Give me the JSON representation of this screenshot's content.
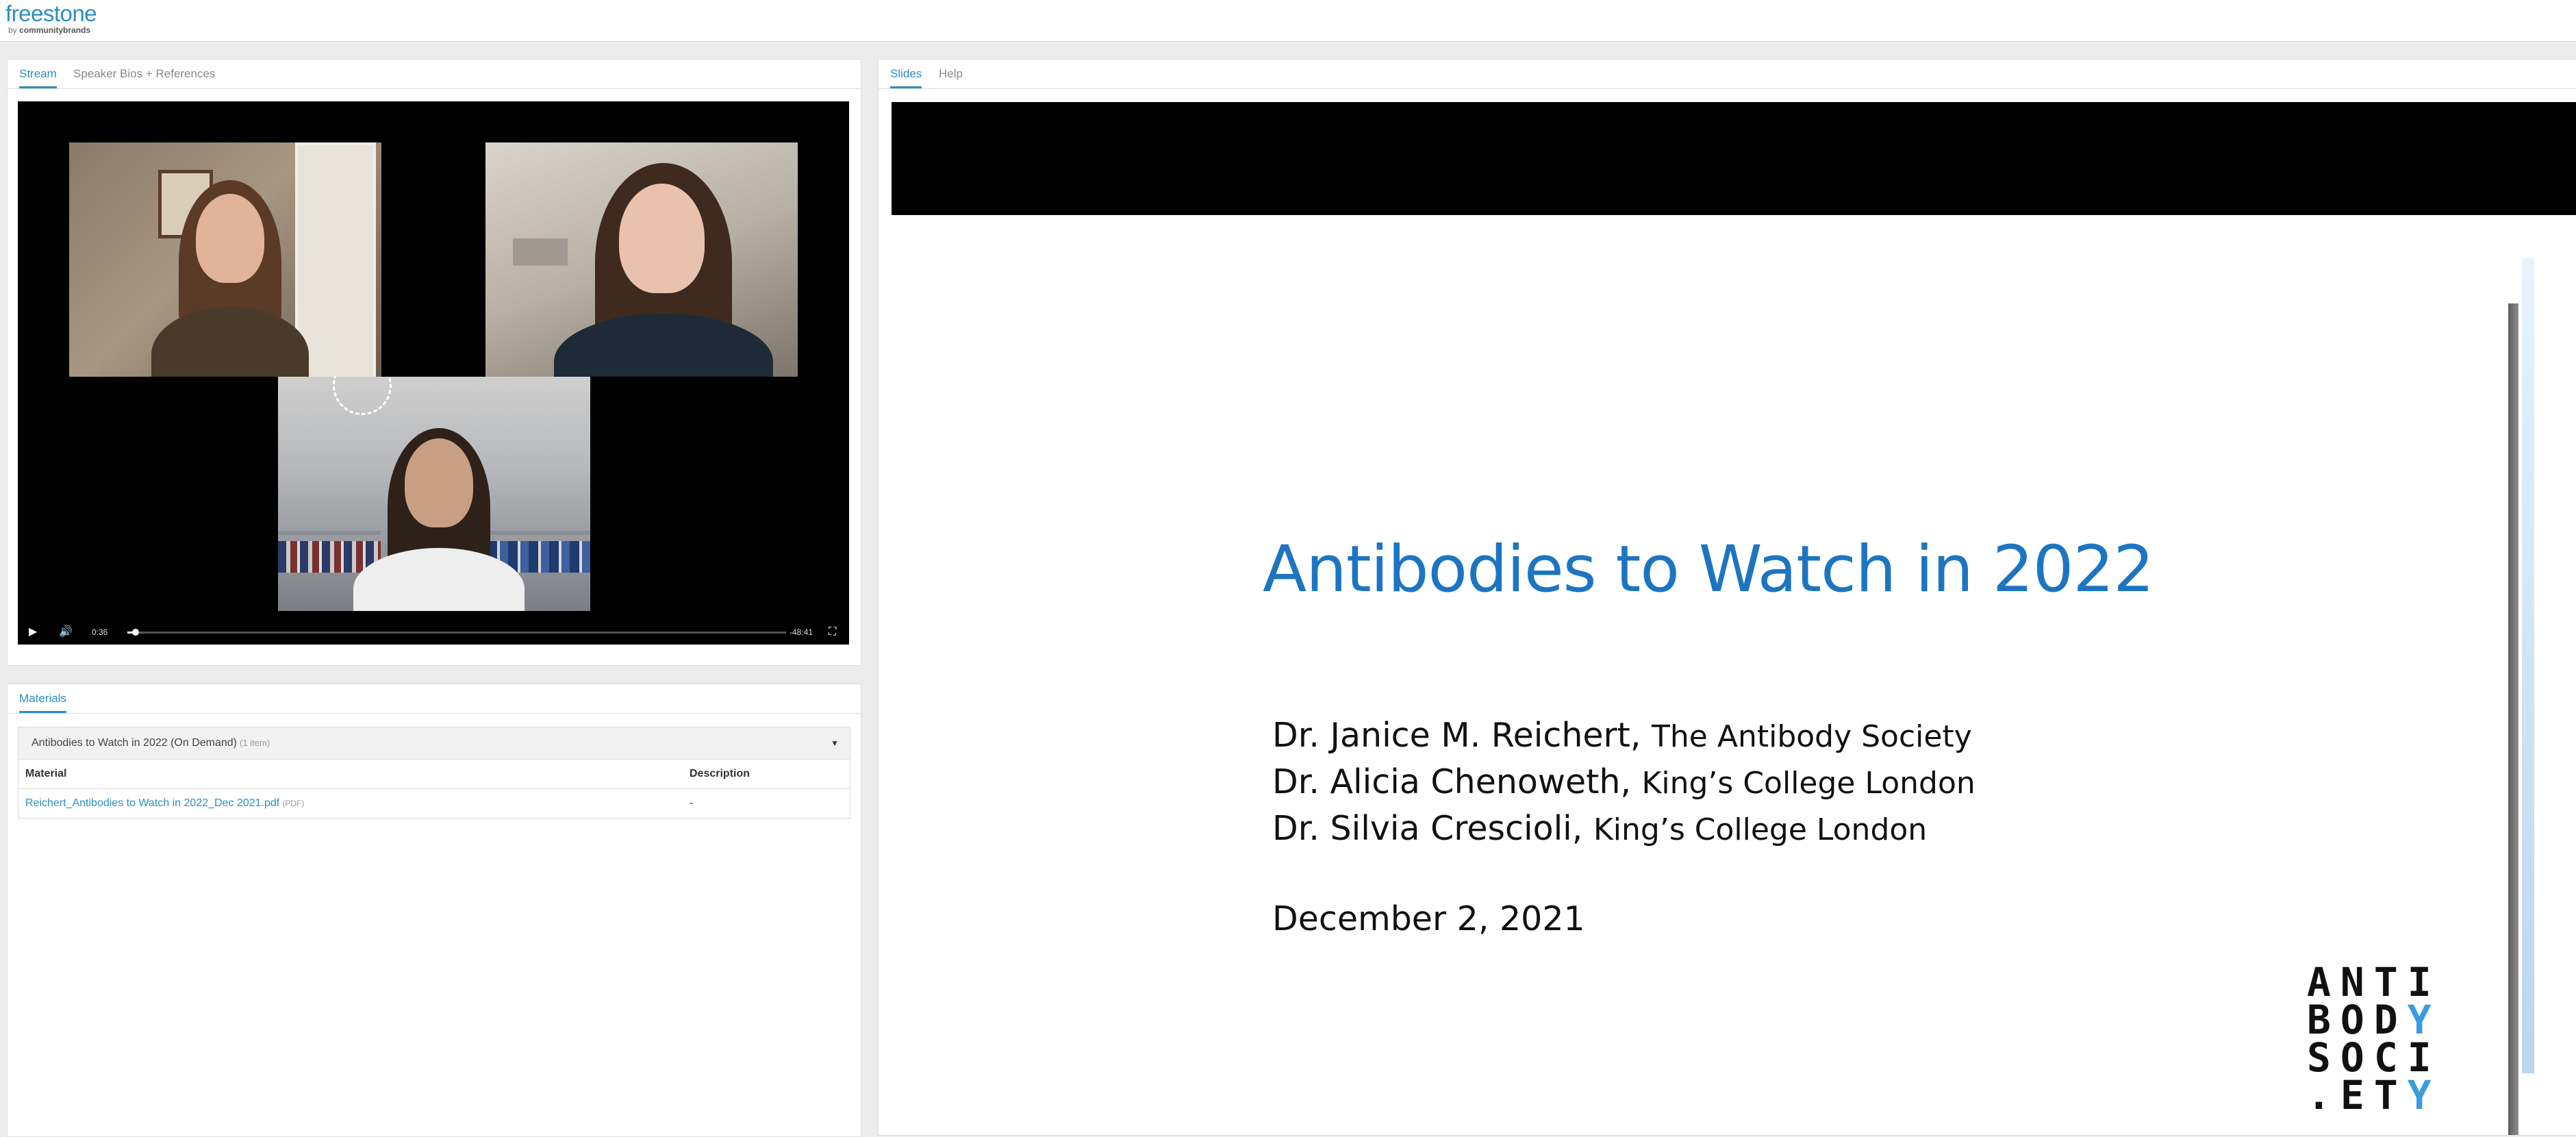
{
  "header": {
    "logo": "freestone",
    "logo_sub_prefix": "by",
    "logo_sub_brand": "communitybrands"
  },
  "stream_panel": {
    "tabs": [
      {
        "label": "Stream",
        "active": true
      },
      {
        "label": "Speaker Bios + References",
        "active": false
      }
    ],
    "player": {
      "current_time": "0:36",
      "remaining_time": "-48:41",
      "progress": 0.012
    }
  },
  "materials_panel": {
    "tab": "Materials",
    "collection": {
      "title": "Antibodies to Watch in 2022 (On Demand)",
      "count": "(1 item)"
    },
    "table": {
      "headers": [
        "Material",
        "Description"
      ],
      "rows": [
        {
          "material": "Reichert_Antibodies to Watch in 2022_Dec 2021.pdf",
          "type": "(PDF)",
          "description": "-"
        }
      ]
    }
  },
  "slides_panel": {
    "tabs": [
      {
        "label": "Slides",
        "active": true
      },
      {
        "label": "Help",
        "active": false
      }
    ],
    "slide": {
      "title": "Antibodies to Watch in 2022",
      "speakers": [
        {
          "name": "Dr. Janice M. Reichert,",
          "affiliation": "The Antibody Society"
        },
        {
          "name": "Dr. Alicia Chenoweth,",
          "affiliation": "King’s College London"
        },
        {
          "name": "Dr. Silvia Crescioli,",
          "affiliation": "King’s College London"
        }
      ],
      "date": "December 2, 2021",
      "logo_rows": [
        [
          "A",
          "N",
          "T",
          "I"
        ],
        [
          "B",
          "O",
          "D",
          "Y"
        ],
        [
          "S",
          "O",
          "C",
          "I"
        ],
        [
          ".",
          "E",
          "T",
          "Y"
        ]
      ]
    }
  },
  "colors": {
    "accent": "#2c8fbf",
    "slide_title": "#1d75c2",
    "logo_blue": "#3a9be0"
  }
}
